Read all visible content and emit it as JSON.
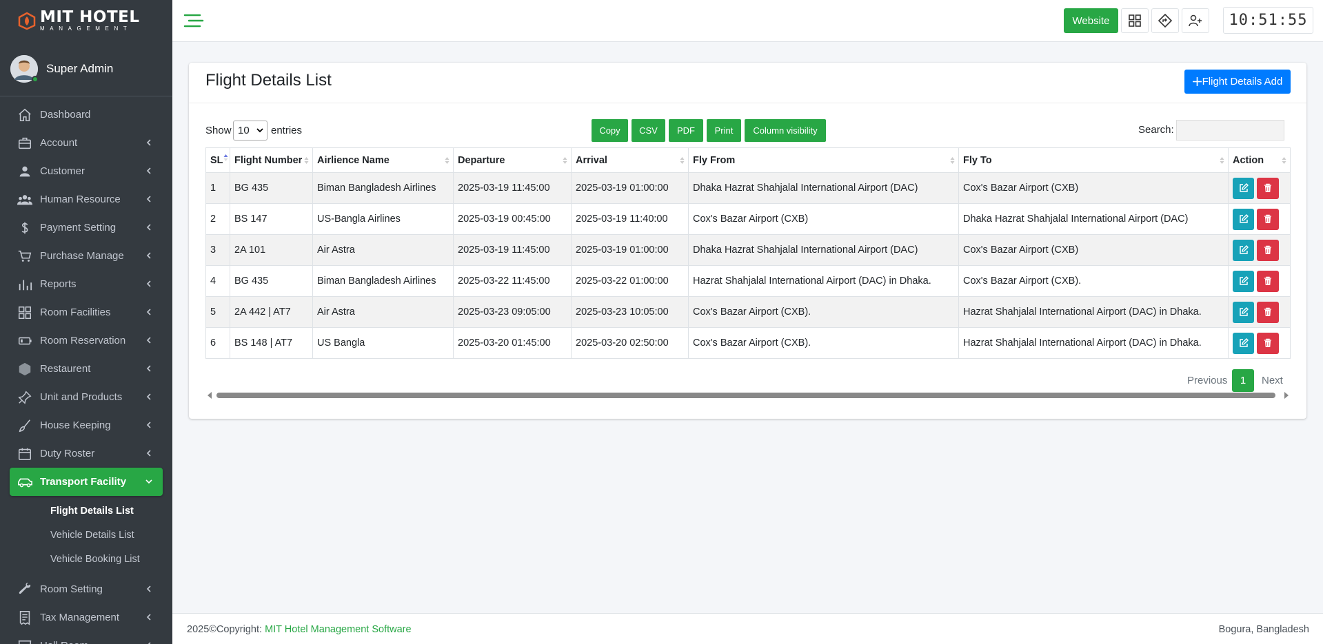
{
  "brand": {
    "main": "MIT HOTEL",
    "sub": "MANAGEMENT"
  },
  "user": {
    "name": "Super Admin"
  },
  "sidebar": {
    "items": [
      {
        "label": "Dashboard",
        "icon": "home-icon",
        "has_children": false
      },
      {
        "label": "Account",
        "icon": "briefcase-icon",
        "has_children": true
      },
      {
        "label": "Customer",
        "icon": "user-icon",
        "has_children": true
      },
      {
        "label": "Human Resource",
        "icon": "users-icon",
        "has_children": true
      },
      {
        "label": "Payment Setting",
        "icon": "dollar-icon",
        "has_children": true
      },
      {
        "label": "Purchase Manage",
        "icon": "cart-icon",
        "has_children": true
      },
      {
        "label": "Reports",
        "icon": "bar-chart-icon",
        "has_children": true
      },
      {
        "label": "Room Facilities",
        "icon": "grid-icon",
        "has_children": true
      },
      {
        "label": "Room Reservation",
        "icon": "battery-icon",
        "has_children": true
      },
      {
        "label": "Restaurent",
        "icon": "hexagon-icon",
        "has_children": true
      },
      {
        "label": "Unit and Products",
        "icon": "pin-icon",
        "has_children": true
      },
      {
        "label": "House Keeping",
        "icon": "broom-icon",
        "has_children": true
      },
      {
        "label": "Duty Roster",
        "icon": "calendar-icon",
        "has_children": true
      },
      {
        "label": "Transport Facility",
        "icon": "car-icon",
        "has_children": true,
        "active": true
      },
      {
        "label": "Room Setting",
        "icon": "wrench-icon",
        "has_children": true
      },
      {
        "label": "Tax Management",
        "icon": "receipt-icon",
        "has_children": true
      },
      {
        "label": "Hall Room",
        "icon": "presentation-icon",
        "has_children": true
      }
    ],
    "sub_items": [
      "Flight Details List",
      "Vehicle Details List",
      "Vehicle Booking List"
    ]
  },
  "header": {
    "website_label": "Website",
    "clock": "10:51:55"
  },
  "card": {
    "title": "Flight Details List",
    "add_label": "Flight Details Add"
  },
  "table_controls": {
    "show_label": "Show",
    "entries_value": "10",
    "entries_label": "entries",
    "export_buttons": [
      "Copy",
      "CSV",
      "PDF",
      "Print",
      "Column visibility"
    ],
    "search_label": "Search:",
    "search_value": ""
  },
  "table": {
    "columns": [
      "SL",
      "Flight Number",
      "Airlience Name",
      "Departure",
      "Arrival",
      "Fly From",
      "Fly To",
      "Action"
    ],
    "rows": [
      [
        "1",
        "BG 435",
        "Biman Bangladesh Airlines",
        "2025-03-19 11:45:00",
        "2025-03-19 01:00:00",
        "Dhaka Hazrat Shahjalal International Airport (DAC)",
        "Cox's Bazar Airport (CXB)"
      ],
      [
        "2",
        "BS 147",
        "US-Bangla Airlines",
        "2025-03-19 00:45:00",
        "2025-03-19 11:40:00",
        "Cox's Bazar Airport (CXB)",
        "Dhaka Hazrat Shahjalal International Airport (DAC)"
      ],
      [
        "3",
        "2A 101",
        "Air Astra",
        "2025-03-19 11:45:00",
        "2025-03-19 01:00:00",
        "Dhaka Hazrat Shahjalal International Airport (DAC)",
        "Cox's Bazar Airport (CXB)"
      ],
      [
        "4",
        "BG 435",
        "Biman Bangladesh Airlines",
        "2025-03-22 11:45:00",
        "2025-03-22 01:00:00",
        "Hazrat Shahjalal International Airport (DAC) in Dhaka.",
        "Cox's Bazar Airport (CXB)."
      ],
      [
        "5",
        "2A 442 | AT7",
        "Air Astra",
        "2025-03-23 09:05:00",
        "2025-03-23 10:05:00",
        "Cox's Bazar Airport (CXB).",
        "Hazrat Shahjalal International Airport (DAC) in Dhaka."
      ],
      [
        "6",
        "BS 148 | AT7",
        "US Bangla",
        "2025-03-20 01:45:00",
        "2025-03-20 02:50:00",
        "Cox's Bazar Airport (CXB).",
        "Hazrat Shahjalal International Airport (DAC) in Dhaka."
      ]
    ]
  },
  "pagination": {
    "previous": "Previous",
    "current": "1",
    "next": "Next"
  },
  "footer": {
    "copyright": "2025©Copyright: ",
    "link_text": "MIT Hotel Management Software",
    "location": "Bogura, Bangladesh"
  },
  "colors": {
    "sidebar_bg": "#343a40",
    "accent_green": "#28a745",
    "primary_blue": "#007bff",
    "edit_teal": "#17a2b8",
    "delete_red": "#dc3545"
  }
}
